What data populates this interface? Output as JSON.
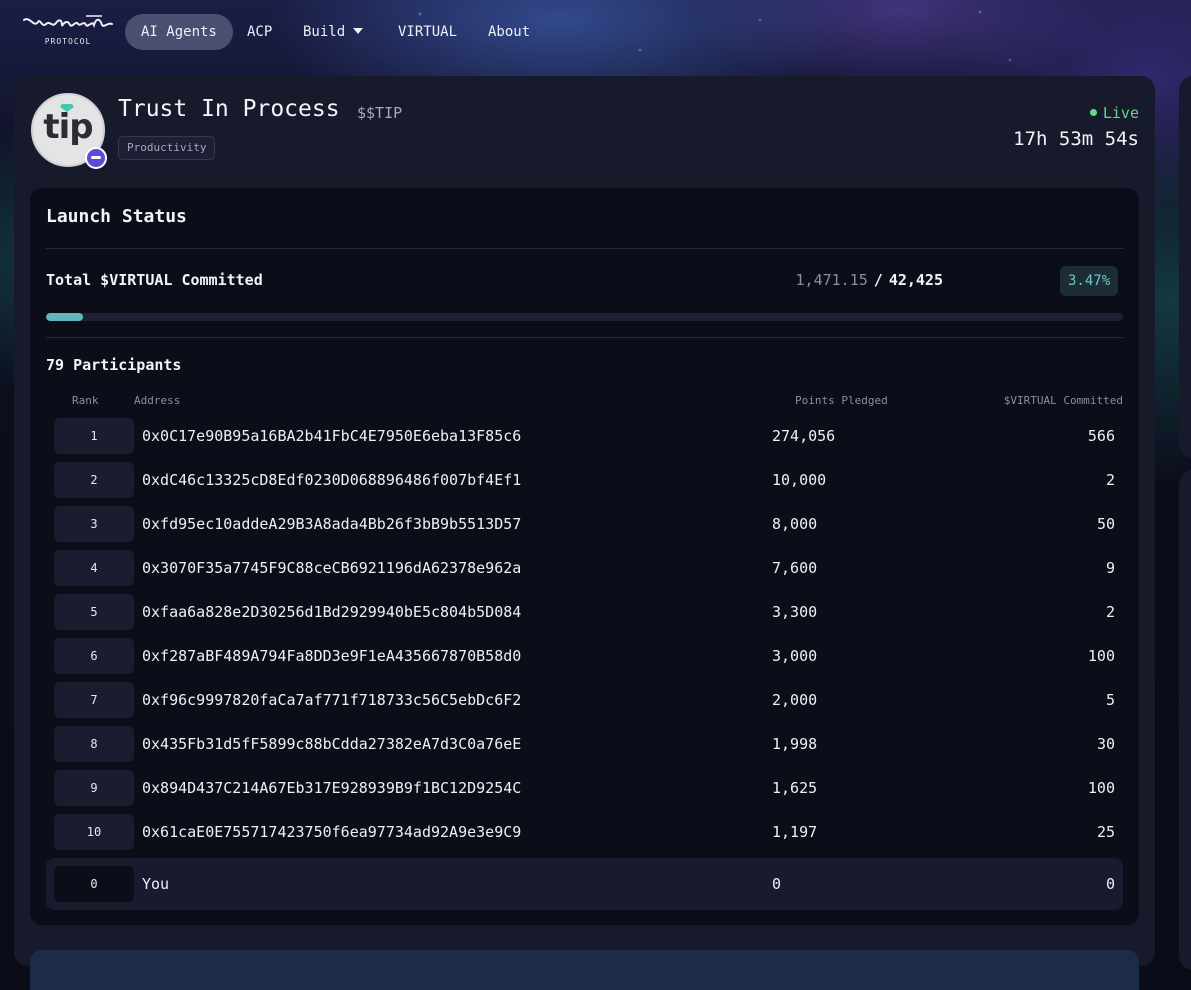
{
  "nav": {
    "logo_text": "virtuals",
    "logo_sub": "PROTOCOL",
    "items": [
      {
        "label": "AI Agents",
        "active": true
      },
      {
        "label": "ACP",
        "active": false
      },
      {
        "label": "Build",
        "active": false,
        "has_dropdown": true
      },
      {
        "label": "VIRTUAL",
        "active": false
      },
      {
        "label": "About",
        "active": false
      }
    ]
  },
  "agent": {
    "name": "Trust In Process",
    "ticker": "$$TIP",
    "avatar_text": "tip",
    "category": "Productivity",
    "status": "Live",
    "countdown": "17h 53m 54s"
  },
  "launch": {
    "title": "Launch Status",
    "committed_label": "Total $VIRTUAL Committed",
    "committed_now": "1,471.15",
    "committed_sep": "/",
    "committed_total": "42,425",
    "percent": "3.47%",
    "progress_fraction": 0.0347,
    "participants_title": "79 Participants",
    "columns": {
      "rank": "Rank",
      "address": "Address",
      "points": "Points Pledged",
      "virtual": "$VIRTUAL Committed"
    },
    "rows": [
      {
        "rank": "1",
        "address": "0x0C17e90B95a16BA2b41FbC4E7950E6eba13F85c6",
        "points": "274,056",
        "virtual": "566"
      },
      {
        "rank": "2",
        "address": "0xdC46c13325cD8Edf0230D068896486f007bf4Ef1",
        "points": "10,000",
        "virtual": "2"
      },
      {
        "rank": "3",
        "address": "0xfd95ec10addeA29B3A8ada4Bb26f3bB9b5513D57",
        "points": "8,000",
        "virtual": "50"
      },
      {
        "rank": "4",
        "address": "0x3070F35a7745F9C88ceCB6921196dA62378e962a",
        "points": "7,600",
        "virtual": "9"
      },
      {
        "rank": "5",
        "address": "0xfaa6a828e2D30256d1Bd2929940bE5c804b5D084",
        "points": "3,300",
        "virtual": "2"
      },
      {
        "rank": "6",
        "address": "0xf287aBF489A794Fa8DD3e9F1eA435667870B58d0",
        "points": "3,000",
        "virtual": "100"
      },
      {
        "rank": "7",
        "address": "0xf96c9997820faCa7af771f718733c56C5ebDc6F2",
        "points": "2,000",
        "virtual": "5"
      },
      {
        "rank": "8",
        "address": "0x435Fb31d5fF5899c88bCdda27382eA7d3C0a76eE",
        "points": "1,998",
        "virtual": "30"
      },
      {
        "rank": "9",
        "address": "0x894D437C214A67Eb317E928939B9f1BC12D9254C",
        "points": "1,625",
        "virtual": "100"
      },
      {
        "rank": "10",
        "address": "0x61caE0E755717423750f6ea97734ad92A9e3e9C9",
        "points": "1,197",
        "virtual": "25"
      }
    ],
    "you_row": {
      "rank": "0",
      "address": "You",
      "points": "0",
      "virtual": "0"
    }
  },
  "colors": {
    "accent_live": "#5fdc8a",
    "progress": "#62b6bd",
    "percent_text": "#6fc6c8"
  }
}
